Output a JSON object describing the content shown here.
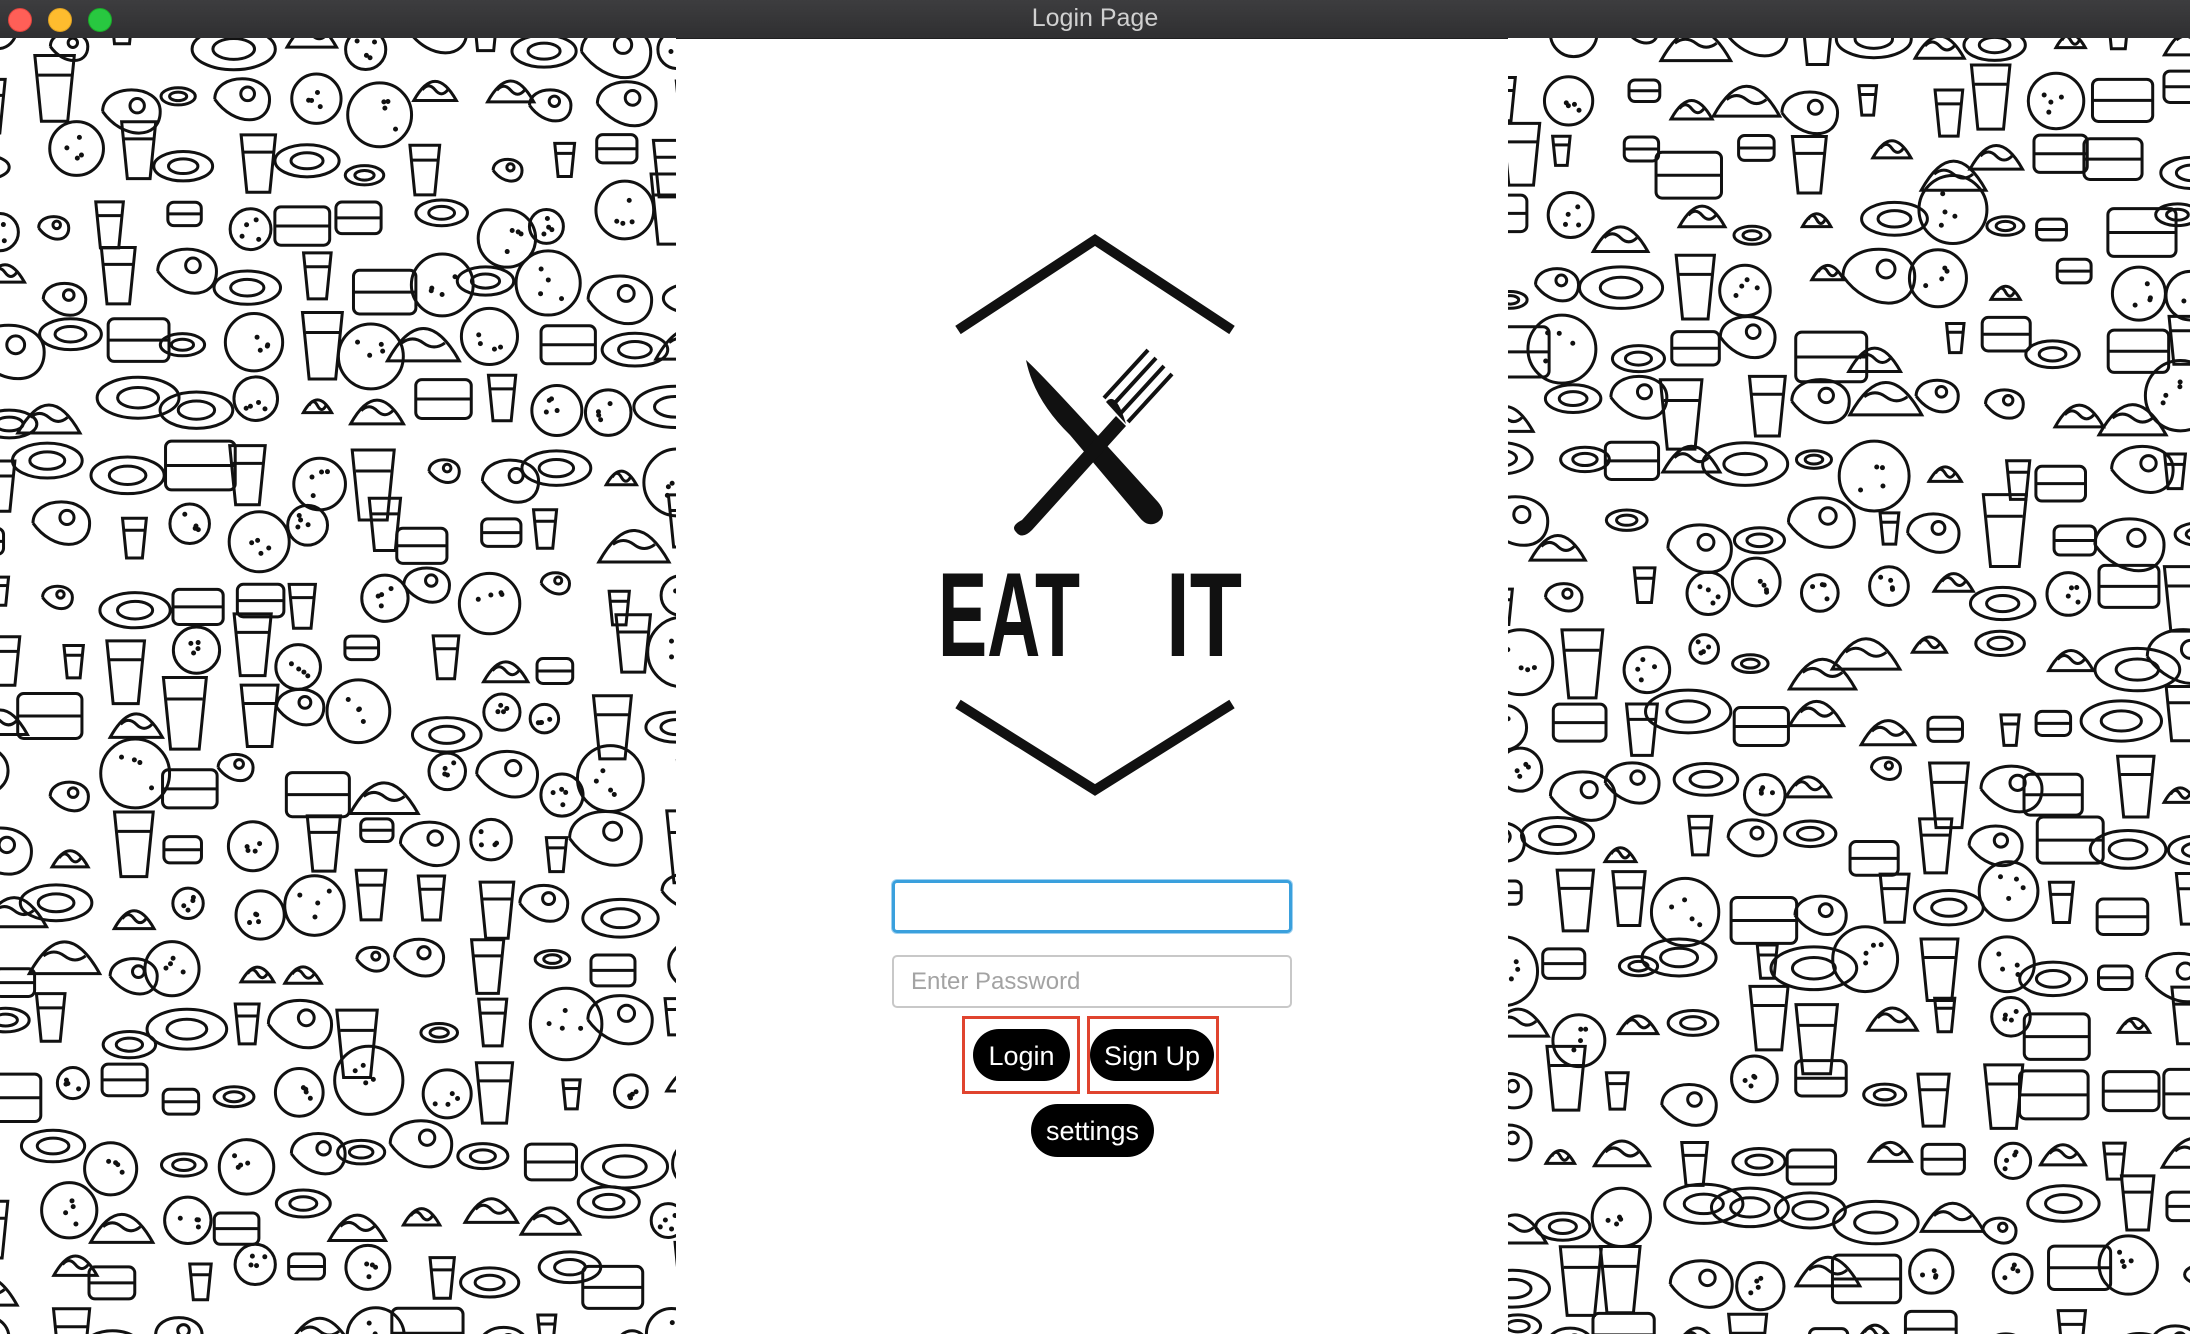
{
  "window": {
    "title": "Login Page"
  },
  "logo": {
    "text": "EAT IT",
    "left_word": "EAT",
    "right_word": "IT"
  },
  "form": {
    "username": {
      "value": "",
      "placeholder": ""
    },
    "password": {
      "value": "",
      "placeholder": "Enter Password"
    }
  },
  "buttons": {
    "login": "Login",
    "signup": "Sign Up",
    "settings": "settings"
  },
  "colors": {
    "titlebar": "#2f2f31",
    "focus_ring": "#3aa0dd",
    "button_bg": "#000000",
    "highlight_outline": "#e0442f"
  }
}
